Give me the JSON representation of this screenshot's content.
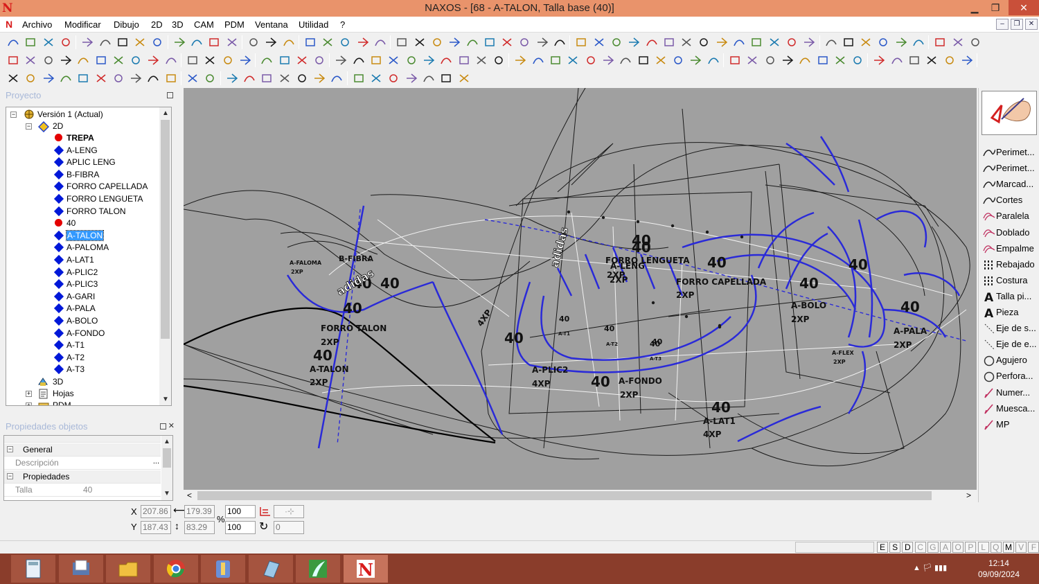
{
  "window": {
    "title": "NAXOS - [68 - A-TALON, Talla base (40)]",
    "logo": "N",
    "minimize": "▁",
    "restore": "❐",
    "close": "✕"
  },
  "menu": {
    "items": [
      "Archivo",
      "Modificar",
      "Dibujo",
      "2D",
      "3D",
      "CAM",
      "PDM",
      "Ventana",
      "Utilidad",
      "?"
    ],
    "mdi_minimize": "‒",
    "mdi_restore": "❐",
    "mdi_close": "✕"
  },
  "project_panel": {
    "title": "Proyecto",
    "tree": {
      "version": "Versión 1 (Actual)",
      "node_2d": "2D",
      "items": [
        {
          "label": "TREPA",
          "kind": "red",
          "bold": true
        },
        {
          "label": "A-LENG",
          "kind": "blue"
        },
        {
          "label": "APLIC LENG",
          "kind": "blue"
        },
        {
          "label": "B-FIBRA",
          "kind": "blue"
        },
        {
          "label": "FORRO CAPELLADA",
          "kind": "blue"
        },
        {
          "label": "FORRO LENGUETA",
          "kind": "blue"
        },
        {
          "label": "FORRO TALON",
          "kind": "blue"
        },
        {
          "label": "40",
          "kind": "red"
        },
        {
          "label": "A-TALON",
          "kind": "blue",
          "selected": true
        },
        {
          "label": "A-PALOMA",
          "kind": "blue"
        },
        {
          "label": "A-LAT1",
          "kind": "blue"
        },
        {
          "label": "A-PLIC2",
          "kind": "blue"
        },
        {
          "label": "A-PLIC3",
          "kind": "blue"
        },
        {
          "label": "A-GARI",
          "kind": "blue"
        },
        {
          "label": "A-PALA",
          "kind": "blue"
        },
        {
          "label": "A-BOLO",
          "kind": "blue"
        },
        {
          "label": "A-FONDO",
          "kind": "blue"
        },
        {
          "label": "A-T1",
          "kind": "blue"
        },
        {
          "label": "A-T2",
          "kind": "blue"
        },
        {
          "label": "A-T3",
          "kind": "blue"
        }
      ],
      "node_3d": "3D",
      "node_hojas": "Hojas",
      "node_pdm": "PDM",
      "scroll_up": "▲",
      "scroll_down": "▼"
    }
  },
  "properties_panel": {
    "title": "Propiedades objetos",
    "group_general": "General",
    "descripcion_label": "Descripción",
    "descripcion_value": "",
    "browse": "...",
    "group_propiedades": "Propiedades",
    "talla_label": "Talla",
    "talla_value": "40"
  },
  "canvas": {
    "labels": [
      {
        "t": "A-FALOMA",
        "s": 8
      },
      {
        "t": "2XP",
        "s": 8
      },
      {
        "t": "B-FIBRA",
        "s": 11
      },
      {
        "t": "40",
        "s": 20
      },
      {
        "t": "40",
        "s": 20
      },
      {
        "t": "40",
        "s": 20
      },
      {
        "t": "FORRO TALON",
        "s": 12
      },
      {
        "t": "2XP",
        "s": 12
      },
      {
        "t": "40",
        "s": 20
      },
      {
        "t": "A-TALON",
        "s": 12
      },
      {
        "t": "2XP",
        "s": 12
      },
      {
        "t": "40",
        "s": 20
      },
      {
        "t": "40",
        "s": 20
      },
      {
        "t": "FORRO LENGUETA",
        "s": 12
      },
      {
        "t": "A-LENG",
        "s": 12
      },
      {
        "t": "2XP",
        "s": 12
      },
      {
        "t": "2XP",
        "s": 12
      },
      {
        "t": "40",
        "s": 20
      },
      {
        "t": "FORRO CAPELLADA",
        "s": 12
      },
      {
        "t": "2XP",
        "s": 12
      },
      {
        "t": "40",
        "s": 20
      },
      {
        "t": "40",
        "s": 20
      },
      {
        "t": "A-BOLO",
        "s": 12
      },
      {
        "t": "2XP",
        "s": 12
      },
      {
        "t": "40",
        "s": 20
      },
      {
        "t": "A-PALA",
        "s": 12
      },
      {
        "t": "2XP",
        "s": 12
      },
      {
        "t": "40",
        "s": 20
      },
      {
        "t": "A-PLIC2",
        "s": 12
      },
      {
        "t": "4XP",
        "s": 12
      },
      {
        "t": "40",
        "s": 20
      },
      {
        "t": "A-FONDO",
        "s": 12
      },
      {
        "t": "2XP",
        "s": 12
      },
      {
        "t": "40",
        "s": 20
      },
      {
        "t": "A-LAT1",
        "s": 12
      },
      {
        "t": "4XP",
        "s": 12
      },
      {
        "t": "A-FLEX",
        "s": 8
      },
      {
        "t": "2XP",
        "s": 8
      },
      {
        "t": "40",
        "s": 11
      },
      {
        "t": "40",
        "s": 11
      },
      {
        "t": "40",
        "s": 11
      },
      {
        "t": "A-T1",
        "s": 7
      },
      {
        "t": "A-T2",
        "s": 7
      },
      {
        "t": "A-T3",
        "s": 7
      },
      {
        "t": "40",
        "s": 11
      },
      {
        "t": "adidas",
        "s": 16
      },
      {
        "t": "adidas",
        "s": 16
      },
      {
        "t": "4XP",
        "s": 12
      }
    ],
    "scroll_left": "<",
    "scroll_right": ">"
  },
  "tools": [
    {
      "label": "Perimet...",
      "icon": "curve-icon"
    },
    {
      "label": "Perimet...",
      "icon": "curve-icon"
    },
    {
      "label": "Marcad...",
      "icon": "curve-icon"
    },
    {
      "label": "Cortes",
      "icon": "curve-icon"
    },
    {
      "label": "Paralela",
      "icon": "parallel-icon"
    },
    {
      "label": "Doblado",
      "icon": "parallel-icon"
    },
    {
      "label": "Empalme",
      "icon": "parallel-icon"
    },
    {
      "label": "Rebajado",
      "icon": "stitch-icon"
    },
    {
      "label": "Costura",
      "icon": "stitch-icon"
    },
    {
      "label": "Talla pi...",
      "icon": "letter-a-icon"
    },
    {
      "label": "Pieza",
      "icon": "letter-a-icon"
    },
    {
      "label": "Eje de s...",
      "icon": "axis-icon"
    },
    {
      "label": "Eje de e...",
      "icon": "axis-icon"
    },
    {
      "label": "Agujero",
      "icon": "circle-icon"
    },
    {
      "label": "Perfora...",
      "icon": "circle-icon"
    },
    {
      "label": "Numer...",
      "icon": "pen-icon"
    },
    {
      "label": "Muesca...",
      "icon": "pen-icon"
    },
    {
      "label": "MP",
      "icon": "pen-icon"
    }
  ],
  "coords": {
    "x_label": "X",
    "y_label": "Y",
    "x": "207.86",
    "y": "187.43",
    "width": "179.39",
    "height": "83.29",
    "scale_x": "100",
    "scale_y": "100",
    "percent": "%",
    "rotation": "0"
  },
  "status_keys": [
    {
      "k": "E",
      "on": true
    },
    {
      "k": "S",
      "on": true
    },
    {
      "k": "D",
      "on": true
    },
    {
      "k": "C",
      "on": false
    },
    {
      "k": "G",
      "on": false
    },
    {
      "k": "A",
      "on": false
    },
    {
      "k": "O",
      "on": false
    },
    {
      "k": "P",
      "on": false
    },
    {
      "k": "L",
      "on": false
    },
    {
      "k": "Q",
      "on": false
    },
    {
      "k": "M",
      "on": true
    },
    {
      "k": "V",
      "on": false
    },
    {
      "k": "F",
      "on": false
    }
  ],
  "taskbar": {
    "apps": [
      "calculator-icon",
      "explorer-icon",
      "folder-icon",
      "chrome-icon",
      "app-icon",
      "notes-icon",
      "leaf-app-icon",
      "naxos-icon"
    ],
    "tray": "▲  🏳  ▮▮▮",
    "time": "12:14",
    "date": "09/09/2024"
  },
  "colors": {
    "titlebar": "#e9936b",
    "canvas": "#a0a0a0",
    "selection": "#3399ff",
    "taskbar": "#8a3d2b",
    "piece_blue": "#2a2ad8"
  }
}
